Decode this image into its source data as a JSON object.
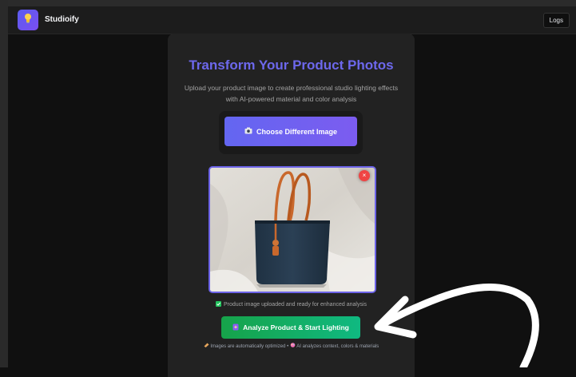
{
  "header": {
    "app_title": "Studioify",
    "logs_label": "Logs"
  },
  "main": {
    "headline": "Transform Your Product Photos",
    "subtitle": "Upload your product image to create professional studio lighting effects with AI-powered material and color analysis",
    "choose_button_label": "Choose Different Image",
    "remove_label": "×",
    "upload_status": "Product image uploaded and ready for enhanced analysis",
    "analyze_button_label": "Analyze Product & Start Lighting",
    "footnote_left": "Images are automatically optimized",
    "footnote_separator": "•",
    "footnote_right": "AI analyzes context, colors & materials"
  },
  "icons": {
    "logo": "lightbulb-icon",
    "choose": "camera-icon",
    "analyze": "sparkle-icon",
    "status": "check-icon",
    "foot_left": "ruler-icon",
    "foot_right": "palette-icon",
    "overlay": "curved-arrow-icon"
  },
  "colors": {
    "accent": "#6366f1",
    "headline": "#6d68ec",
    "analyze": "#10b981",
    "remove": "#ef4444",
    "background": "#101010",
    "card": "#222222"
  }
}
